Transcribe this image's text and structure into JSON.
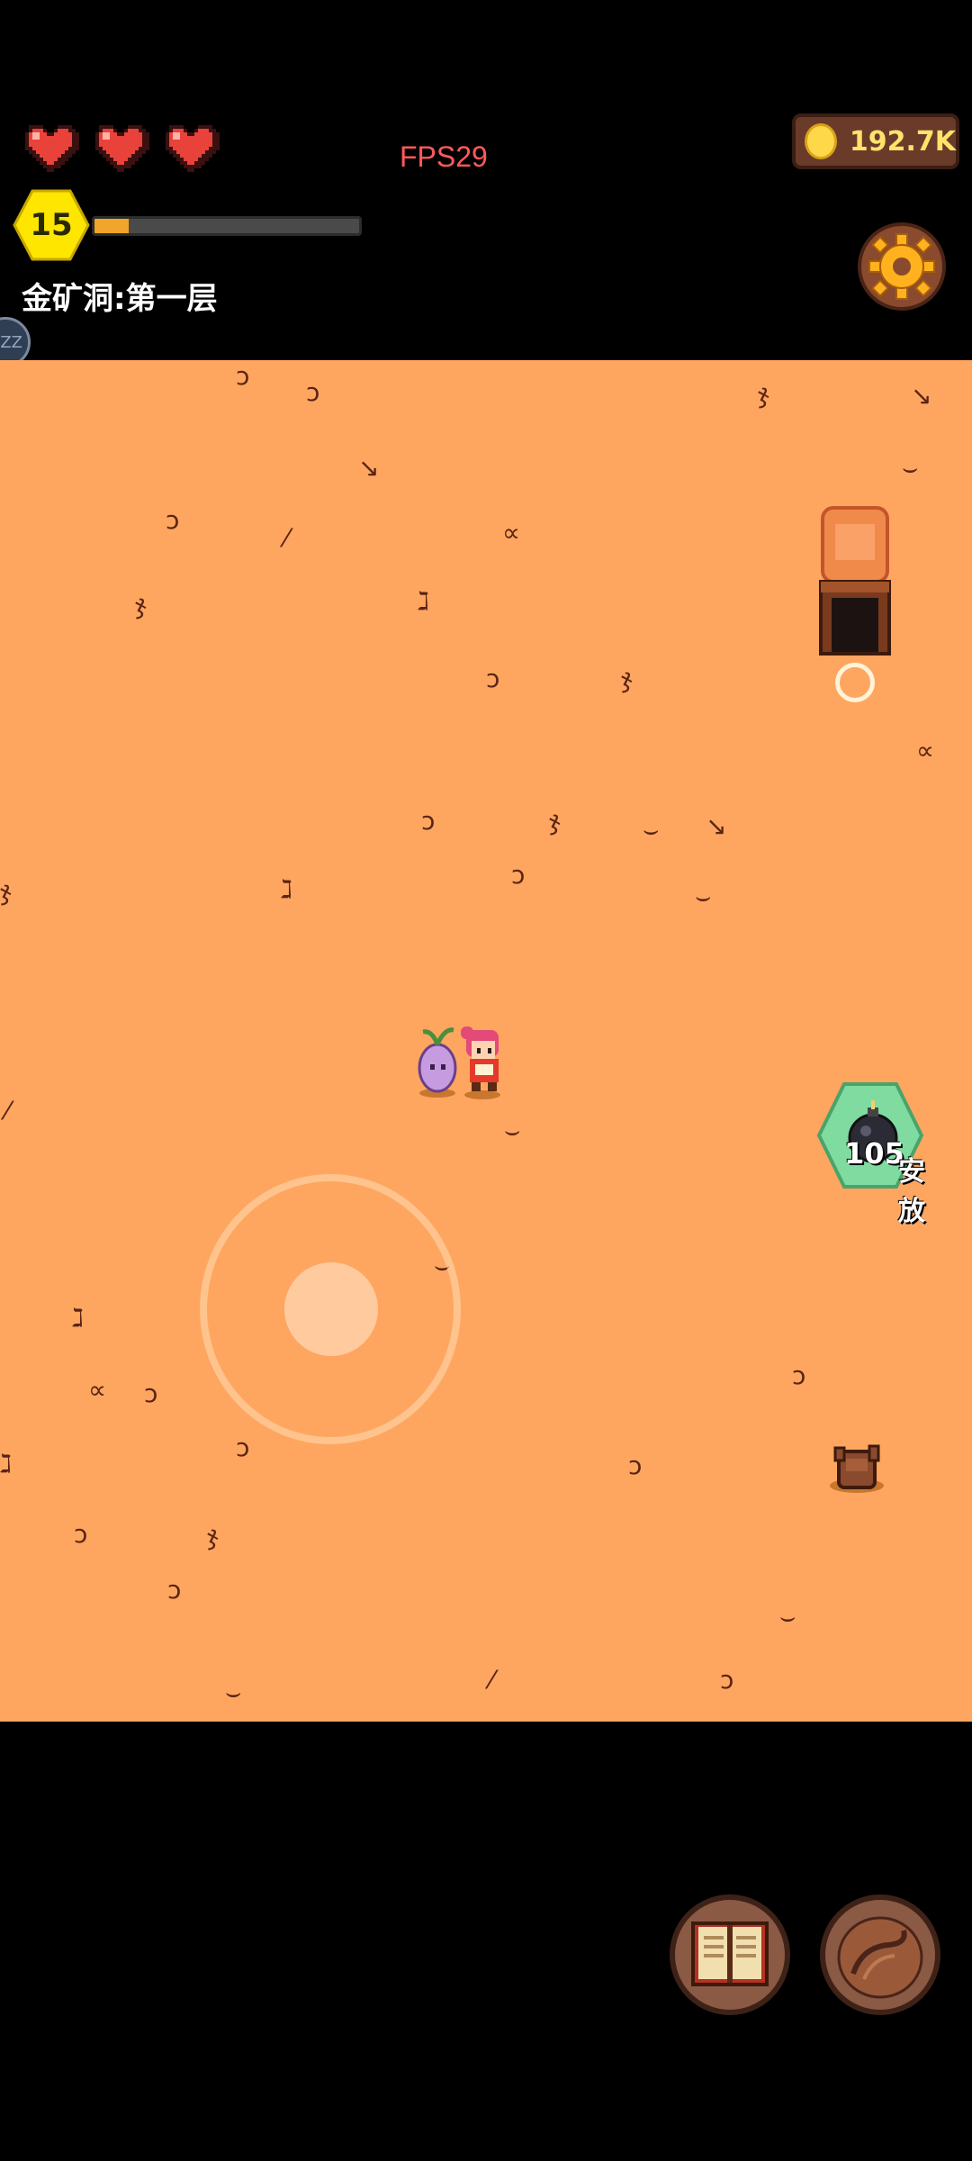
{
  "hud": {
    "hearts": [
      {
        "icon": "heart-icon",
        "filled": true
      },
      {
        "icon": "heart-icon",
        "filled": true
      },
      {
        "icon": "heart-icon",
        "filled": true
      }
    ],
    "fps_text": "FPS29",
    "level": "15",
    "xp_progress": 0.13,
    "location_text": "金矿洞:第一层",
    "side_orb_text": "ZZ",
    "coins": "192.7K"
  },
  "actions": {
    "bomb_count": "105",
    "bomb_label": "安放"
  },
  "colors": {
    "ground": "#fea660",
    "crack": "#5a2414",
    "heart": "#e8423b",
    "coin": "#ffd84a",
    "xp_fill": "#f2a52b",
    "level_badge": "#ffe600",
    "bomb_button": "#7fdba0",
    "fps_text": "#ff5a5a"
  },
  "icons": {
    "settings": "gear-icon",
    "book": "book-icon",
    "bag": "bag-icon",
    "bomb": "bomb-icon",
    "coin": "coin-icon"
  }
}
